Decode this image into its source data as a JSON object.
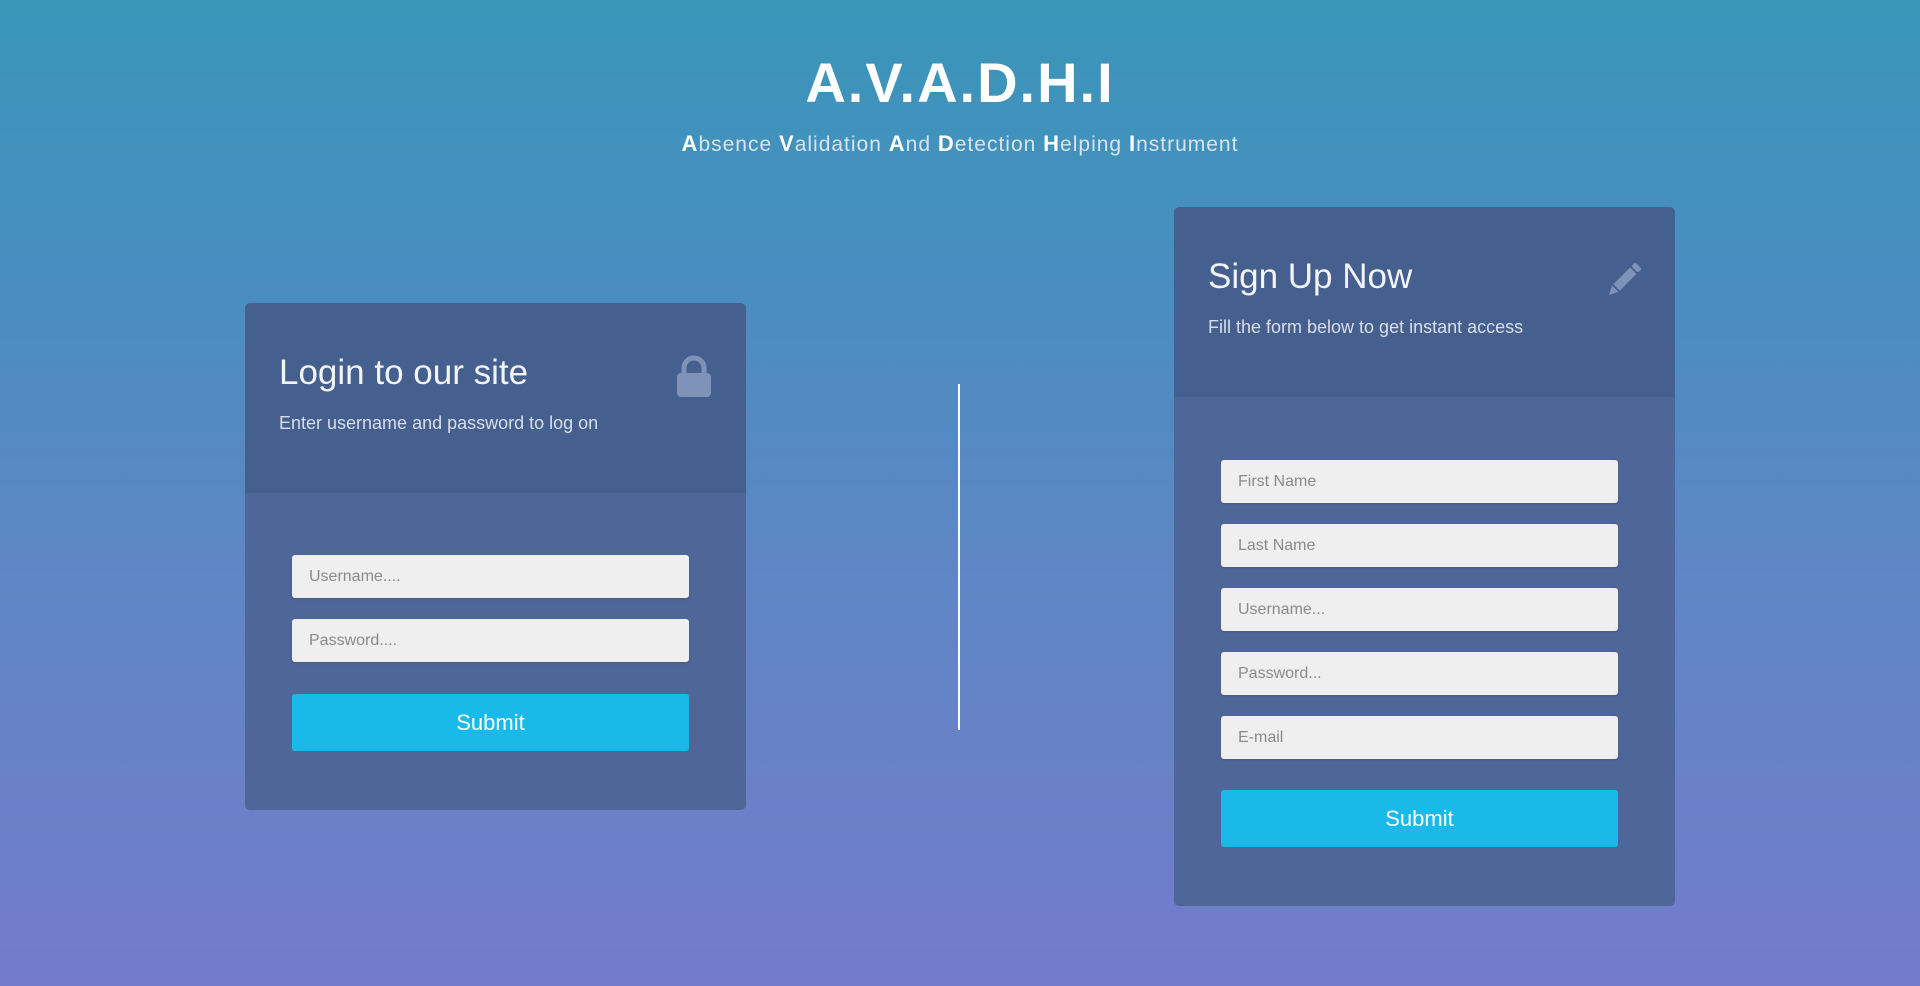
{
  "header": {
    "title": "A.V.A.D.H.I",
    "subtitle_words": [
      {
        "initial": "A",
        "rest": "bsence"
      },
      {
        "initial": "V",
        "rest": "alidation"
      },
      {
        "initial": "A",
        "rest": "nd"
      },
      {
        "initial": "D",
        "rest": "etection"
      },
      {
        "initial": "H",
        "rest": "elping"
      },
      {
        "initial": "I",
        "rest": "nstrument"
      }
    ]
  },
  "login": {
    "title": "Login to our site",
    "description": "Enter username and password to log on",
    "icon": "lock-icon",
    "username_placeholder": "Username....",
    "password_placeholder": "Password....",
    "submit_label": "Submit"
  },
  "signup": {
    "title": "Sign Up Now",
    "description": "Fill the form below to get instant access",
    "icon": "pencil-icon",
    "first_name_placeholder": "First Name",
    "last_name_placeholder": "Last Name",
    "username_placeholder": "Username...",
    "password_placeholder": "Password...",
    "email_placeholder": "E-mail",
    "submit_label": "Submit"
  },
  "colors": {
    "card_header": "#455f8f",
    "card_body": "#4f6699",
    "button": "#19b9e9",
    "field": "#efefef"
  }
}
